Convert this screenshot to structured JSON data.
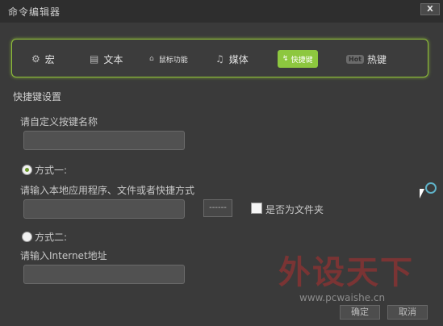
{
  "window": {
    "title": "命令编辑器",
    "close_label": "X"
  },
  "toolbar": {
    "items": [
      {
        "label": "宏",
        "icon": "gear-icon"
      },
      {
        "label": "文本",
        "icon": "document-icon"
      },
      {
        "label": "鼠标功能",
        "icon": "mouse-icon"
      },
      {
        "label": "媒体",
        "icon": "music-note-icon"
      },
      {
        "label": "快捷键",
        "icon": "keyboard-shortcut-icon",
        "active": true
      },
      {
        "label": "热键",
        "icon": "hot-badge-icon",
        "badge": "Hot"
      }
    ],
    "accent": "#8dc73f"
  },
  "form": {
    "section_title": "快捷键设置",
    "name_label": "请自定义按键名称",
    "name_value": "",
    "option1_label": "方式一:",
    "option1_checked": true,
    "app_label": "请输入本地应用程序、文件或者快捷方式",
    "app_value": "",
    "browse_label": "------",
    "folder_checkbox_label": "是否为文件夹",
    "folder_checked": false,
    "option2_label": "方式二:",
    "option2_checked": false,
    "internet_label": "请输入Internet地址",
    "internet_value": ""
  },
  "footer": {
    "ok_label": "确定",
    "cancel_label": "取消"
  },
  "watermark": {
    "logo_text": "外设天下",
    "url": "www.pcwaishe.cn"
  }
}
